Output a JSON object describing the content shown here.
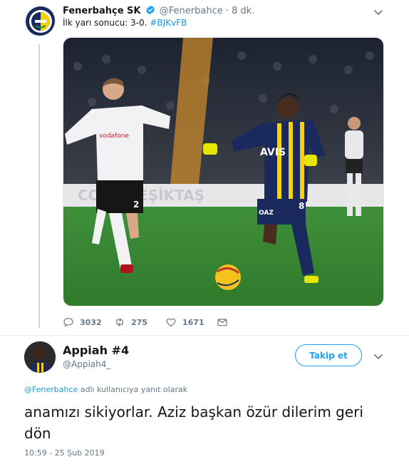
{
  "original_tweet": {
    "author_name": "Fenerbahçe SK",
    "handle": "@Fenerbahce",
    "separator": "·",
    "time_ago": "8 dk.",
    "text": "İlk yarı sonucu: 3-0. ",
    "hashtag": "#BJKvFB",
    "media": {
      "scene_text_vodafone": "vodafone",
      "scene_text_avis": "AVIS",
      "scene_text_board": "CONS  BEŞİKTAŞ",
      "scene_text_number_left": "2",
      "scene_text_number_right": "8",
      "scene_text_shorts": "OAZ"
    },
    "actions": {
      "replies": "3032",
      "retweets": "275",
      "likes": "1671"
    }
  },
  "reply_tweet": {
    "author_name": "Appiah #4",
    "handle": "@Appiah4_",
    "follow_label": "Takip et",
    "reply_to_mention": "@Fenerbahce",
    "reply_to_suffix": " adlı kullanıcıya yanıt olarak",
    "text": "anamızı sikiyorlar. Aziz başkan özür dilerim geri dön",
    "timestamp": "10:59 - 25 Şub 2019"
  },
  "colors": {
    "accent": "#1da1f2",
    "link": "#1b95e0",
    "muted": "#657786",
    "text": "#14171a",
    "divider": "#e6ecf0",
    "fb_navy": "#1b2a5e",
    "fb_yellow": "#f5d20b"
  },
  "icons": {
    "verified": "verified-badge-icon",
    "caret": "chevron-down-icon",
    "reply": "reply-icon",
    "retweet": "retweet-icon",
    "like": "heart-icon",
    "dm": "envelope-icon"
  }
}
